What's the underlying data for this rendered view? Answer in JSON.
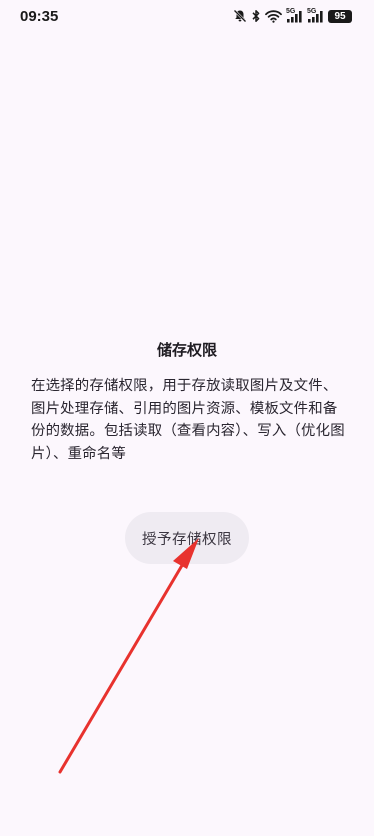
{
  "status_bar": {
    "time": "09:35",
    "network_1": "5G",
    "network_2": "5G",
    "battery": "95",
    "icons": [
      "bell-off-icon",
      "bluetooth-icon",
      "wifi-icon",
      "signal-icon",
      "signal-icon",
      "battery-icon"
    ]
  },
  "dialog": {
    "title": "储存权限",
    "message": "在选择的存储权限，用于存放读取图片及文件、图片处理存储、引用的图片资源、模板文件和备份的数据。包括读取（查看内容）、写入（优化图片）、重命名等",
    "grant_button_label": "授予存储权限"
  },
  "annotation": {
    "arrow_color": "#e8322e"
  }
}
